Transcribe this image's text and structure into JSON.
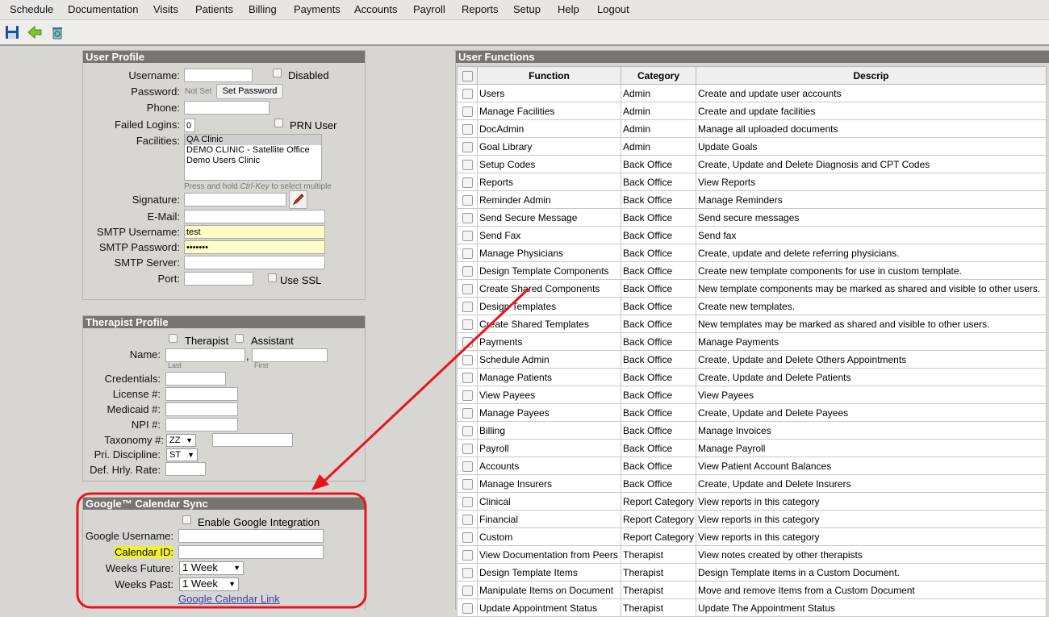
{
  "menu": [
    "Schedule",
    "Documentation",
    "Visits",
    "Patients",
    "Billing",
    "Payments",
    "Accounts",
    "Payroll",
    "Reports",
    "Setup",
    "Help",
    "Logout"
  ],
  "toolbar": {
    "icons": [
      "save-icon",
      "back-arrow-icon",
      "recycle-icon"
    ]
  },
  "user_profile": {
    "title": "User Profile",
    "username_label": "Username:",
    "disabled_label": "Disabled",
    "password_label": "Password:",
    "password_status": "Not Set",
    "set_password_button": "Set Password",
    "phone_label": "Phone:",
    "failed_logins_label": "Failed Logins:",
    "failed_logins_value": "0",
    "prn_user_label": "PRN User",
    "facilities_label": "Facilities:",
    "facilities": [
      "QA Clinic",
      "DEMO CLINIC - Satellite Office",
      "Demo Users Clinic"
    ],
    "facilities_hint_pre": "Press and hold ",
    "facilities_hint_key": "Ctrl-Key",
    "facilities_hint_post": " to select multiple",
    "signature_label": "Signature:",
    "email_label": "E-Mail:",
    "smtp_username_label": "SMTP Username:",
    "smtp_username_value": "test",
    "smtp_password_label": "SMTP Password:",
    "smtp_password_value": "•••••••",
    "smtp_server_label": "SMTP Server:",
    "port_label": "Port:",
    "use_ssl_label": "Use SSL"
  },
  "therapist_profile": {
    "title": "Therapist Profile",
    "therapist_label": "Therapist",
    "assistant_label": "Assistant",
    "name_label": "Name:",
    "name_sep": ",",
    "last_hint": "Last",
    "first_hint": "First",
    "credentials_label": "Credentials:",
    "license_label": "License #:",
    "medicaid_label": "Medicaid #:",
    "npi_label": "NPI #:",
    "taxonomy_label": "Taxonomy #:",
    "taxonomy_value": "ZZ",
    "discipline_label": "Pri. Discipline:",
    "discipline_value": "ST",
    "rate_label": "Def. Hrly. Rate:"
  },
  "google_sync": {
    "title": "Google™ Calendar Sync",
    "enable_label": "Enable Google Integration",
    "username_label": "Google Username:",
    "calendar_id_label": "Calendar ID:",
    "weeks_future_label": "Weeks Future:",
    "weeks_future_value": "1 Week",
    "weeks_past_label": "Weeks Past:",
    "weeks_past_value": "1 Week",
    "calendar_link": "Google Calendar Link"
  },
  "user_functions": {
    "title": "User Functions",
    "columns": [
      "Function",
      "Category",
      "Descrip"
    ],
    "rows": [
      [
        "Users",
        "Admin",
        "Create and update user accounts"
      ],
      [
        "Manage Facilities",
        "Admin",
        "Create and update facilities"
      ],
      [
        "DocAdmin",
        "Admin",
        "Manage all uploaded documents"
      ],
      [
        "Goal Library",
        "Admin",
        "Update Goals"
      ],
      [
        "Setup Codes",
        "Back Office",
        "Create, Update and Delete Diagnosis and CPT Codes"
      ],
      [
        "Reports",
        "Back Office",
        "View Reports"
      ],
      [
        "Reminder Admin",
        "Back Office",
        "Manage Reminders"
      ],
      [
        "Send Secure Message",
        "Back Office",
        "Send secure messages"
      ],
      [
        "Send Fax",
        "Back Office",
        "Send fax"
      ],
      [
        "Manage Physicians",
        "Back Office",
        "Create, update and delete referring physicians."
      ],
      [
        "Design Template Components",
        "Back Office",
        "Create new template components for use in custom template."
      ],
      [
        "Create Shared Components",
        "Back Office",
        "New template components may be marked as shared and visible to other users."
      ],
      [
        "Design Templates",
        "Back Office",
        "Create new templates."
      ],
      [
        "Create Shared Templates",
        "Back Office",
        "New templates may be marked as shared and visible to other users."
      ],
      [
        "Payments",
        "Back Office",
        "Manage Payments"
      ],
      [
        "Schedule Admin",
        "Back Office",
        "Create, Update and Delete Others Appointments"
      ],
      [
        "Manage Patients",
        "Back Office",
        "Create, Update and Delete Patients"
      ],
      [
        "View Payees",
        "Back Office",
        "View Payees"
      ],
      [
        "Manage Payees",
        "Back Office",
        "Create, Update and Delete Payees"
      ],
      [
        "Billing",
        "Back Office",
        "Manage Invoices"
      ],
      [
        "Payroll",
        "Back Office",
        "Manage Payroll"
      ],
      [
        "Accounts",
        "Back Office",
        "View Patient Account Balances"
      ],
      [
        "Manage Insurers",
        "Back Office",
        "Create, Update and Delete Insurers"
      ],
      [
        "Clinical",
        "Report Category",
        "View reports in this category"
      ],
      [
        "Financial",
        "Report Category",
        "View reports in this category"
      ],
      [
        "Custom",
        "Report Category",
        "View reports in this category"
      ],
      [
        "View Documentation from Peers",
        "Therapist",
        "View notes created by other therapists"
      ],
      [
        "Design Template Items",
        "Therapist",
        "Design Template items in a Custom Document."
      ],
      [
        "Manipulate Items on Document",
        "Therapist",
        "Move and remove Items from a Custom Document"
      ],
      [
        "Update Appointment Status",
        "Therapist",
        "Update The Appointment Status"
      ]
    ]
  },
  "colors": {
    "panel_header": "#777571",
    "annotation": "#e8141b",
    "highlight": "#f3f032"
  }
}
